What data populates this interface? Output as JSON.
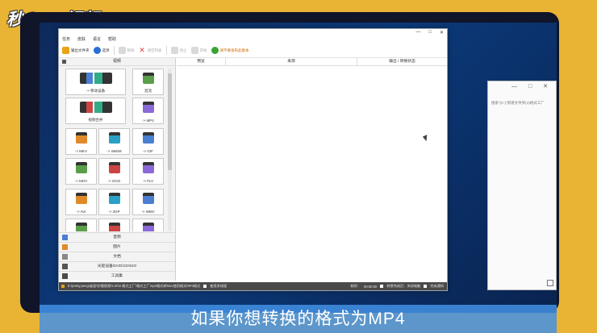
{
  "logo_text": "秒dong视频",
  "background_window": {
    "search_placeholder": "搜索\"(C:)\"新建文件夹(4)格式工厂"
  },
  "app": {
    "window_controls": [
      "—",
      "□",
      "✕"
    ],
    "menu": [
      "任务",
      "皮肤",
      "语言",
      "帮助"
    ],
    "toolbar": [
      {
        "label": "输出文件夹",
        "icon": "folder-icon",
        "color": "#e8a317",
        "enabled": true
      },
      {
        "label": "选项",
        "icon": "options-icon",
        "color": "#2a6fd6",
        "enabled": true
      },
      {
        "label": "移除",
        "icon": "remove-icon",
        "color": "#c9c9c9",
        "enabled": false
      },
      {
        "label": "清空列表",
        "icon": "clear-list-icon",
        "color": "#e04040",
        "enabled": false
      },
      {
        "label": "停止",
        "icon": "stop-icon",
        "color": "#c9c9c9",
        "enabled": false
      },
      {
        "label": "开始",
        "icon": "start-icon",
        "color": "#c9c9c9",
        "enabled": false
      },
      {
        "label": "请不要发布此版本",
        "icon": "globe-icon",
        "color": "#3aa335",
        "enabled": true
      }
    ],
    "left_panel_header": "视频",
    "tiles": [
      {
        "label": "-> 移动设备",
        "icon": "mobile-device-icon"
      },
      {
        "label": "混流",
        "icon": "mux-icon"
      },
      {
        "label": "视频合并",
        "icon": "video-join-icon"
      },
      {
        "label": "-> MP4",
        "icon": "mp4-icon"
      },
      {
        "label": "-> MKV",
        "icon": "mkv-icon"
      },
      {
        "label": "-> WebM",
        "icon": "webm-icon"
      },
      {
        "label": "-> GIF",
        "icon": "gif-icon"
      },
      {
        "label": "-> MOV",
        "icon": "mov-icon"
      },
      {
        "label": "-> OGG",
        "icon": "ogg-icon"
      },
      {
        "label": "-> FLV",
        "icon": "flv-icon"
      },
      {
        "label": "-> AVI",
        "icon": "avi-icon"
      },
      {
        "label": "-> 3GP",
        "icon": "3gp-icon"
      },
      {
        "label": "-> WMV",
        "icon": "wmv-icon"
      },
      {
        "label": "",
        "icon": "mpg-icon"
      },
      {
        "label": "",
        "icon": "vob-icon"
      },
      {
        "label": "",
        "icon": "swf-icon"
      }
    ],
    "categories": [
      {
        "label": "音频",
        "icon": "audio-icon"
      },
      {
        "label": "图片",
        "icon": "picture-icon"
      },
      {
        "label": "文档",
        "icon": "document-icon"
      },
      {
        "label": "光驱设备\\DVD\\CD\\ISO",
        "icon": "disc-icon"
      },
      {
        "label": "工具集",
        "icon": "toolbox-icon"
      }
    ],
    "columns": [
      "预览",
      "来源",
      "输出 / 转换状态"
    ],
    "statusbar": {
      "path": "E:\\pretty.peng\\桌面\\秒懂视频\\3.30\\2.格式工厂\\格式工厂mp4格式转Mov使用格式MP4格式",
      "checkbox_label": "使用多线程",
      "elapsed_label": "耗时：",
      "elapsed_value": "00:00:00",
      "after_convert_label": "转换完成后：关闭电脑",
      "notify_label": "完成通知"
    }
  },
  "caption": "如果你想转换的格式为MP4"
}
